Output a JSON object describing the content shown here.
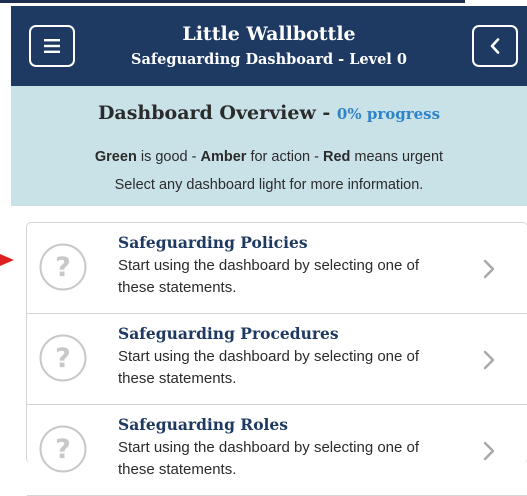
{
  "header": {
    "title": "Little Wallbottle",
    "subtitle": "Safeguarding Dashboard - Level 0",
    "menu_icon": "menu-icon",
    "back_icon": "chevron-left-icon"
  },
  "overview": {
    "title": "Dashboard Overview - ",
    "progress": "0% progress",
    "legend": {
      "green": "Green",
      "green_text": " is good - ",
      "amber": "Amber",
      "amber_text": " for action - ",
      "red": "Red",
      "red_text": " means urgent"
    },
    "hint": "Select any dashboard light for more information."
  },
  "items": [
    {
      "title": "Safeguarding Policies",
      "desc": "Start using the dashboard by selecting one of these statements.",
      "icon": "question-icon"
    },
    {
      "title": "Safeguarding Procedures",
      "desc": "Start using the dashboard by selecting one of these statements.",
      "icon": "question-icon"
    },
    {
      "title": "Safeguarding Roles",
      "desc": "Start using the dashboard by selecting one of these statements.",
      "icon": "question-icon"
    }
  ],
  "colors": {
    "header_bg": "#1e3a63",
    "overview_bg": "#c9e2e8",
    "progress": "#2f83c7",
    "pointer_arrow": "#e02020"
  }
}
